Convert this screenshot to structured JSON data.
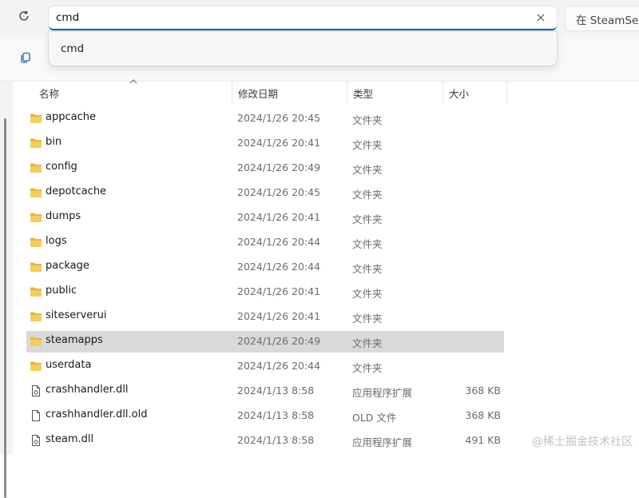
{
  "address_bar": {
    "value": "cmd",
    "clear_icon": "close-icon"
  },
  "search_box": {
    "placeholder": "在 SteamServ"
  },
  "suggestions": [
    {
      "label": "cmd"
    }
  ],
  "columns": {
    "name": "名称",
    "date": "修改日期",
    "type": "类型",
    "size": "大小"
  },
  "files": [
    {
      "name": "appcache",
      "date": "2024/1/26 20:45",
      "type": "文件夹",
      "size": "",
      "icon": "folder-icon"
    },
    {
      "name": "bin",
      "date": "2024/1/26 20:41",
      "type": "文件夹",
      "size": "",
      "icon": "folder-icon"
    },
    {
      "name": "config",
      "date": "2024/1/26 20:49",
      "type": "文件夹",
      "size": "",
      "icon": "folder-icon"
    },
    {
      "name": "depotcache",
      "date": "2024/1/26 20:45",
      "type": "文件夹",
      "size": "",
      "icon": "folder-icon"
    },
    {
      "name": "dumps",
      "date": "2024/1/26 20:41",
      "type": "文件夹",
      "size": "",
      "icon": "folder-icon"
    },
    {
      "name": "logs",
      "date": "2024/1/26 20:44",
      "type": "文件夹",
      "size": "",
      "icon": "folder-icon"
    },
    {
      "name": "package",
      "date": "2024/1/26 20:44",
      "type": "文件夹",
      "size": "",
      "icon": "folder-icon"
    },
    {
      "name": "public",
      "date": "2024/1/26 20:41",
      "type": "文件夹",
      "size": "",
      "icon": "folder-icon"
    },
    {
      "name": "siteserverui",
      "date": "2024/1/26 20:41",
      "type": "文件夹",
      "size": "",
      "icon": "folder-icon"
    },
    {
      "name": "steamapps",
      "date": "2024/1/26 20:49",
      "type": "文件夹",
      "size": "",
      "icon": "folder-icon",
      "selected": true
    },
    {
      "name": "userdata",
      "date": "2024/1/26 20:44",
      "type": "文件夹",
      "size": "",
      "icon": "folder-icon"
    },
    {
      "name": "crashhandler.dll",
      "date": "2024/1/13 8:58",
      "type": "应用程序扩展",
      "size": "368 KB",
      "icon": "dll-file-icon"
    },
    {
      "name": "crashhandler.dll.old",
      "date": "2024/1/13 8:58",
      "type": "OLD 文件",
      "size": "368 KB",
      "icon": "file-icon"
    },
    {
      "name": "steam.dll",
      "date": "2024/1/13 8:58",
      "type": "应用程序扩展",
      "size": "491 KB",
      "icon": "dll-file-icon"
    }
  ],
  "watermark": "@稀土掘金技术社区",
  "colors": {
    "accent": "#005fb8",
    "folder": "#f2c34e",
    "selected_row": "#d9d9d9"
  }
}
